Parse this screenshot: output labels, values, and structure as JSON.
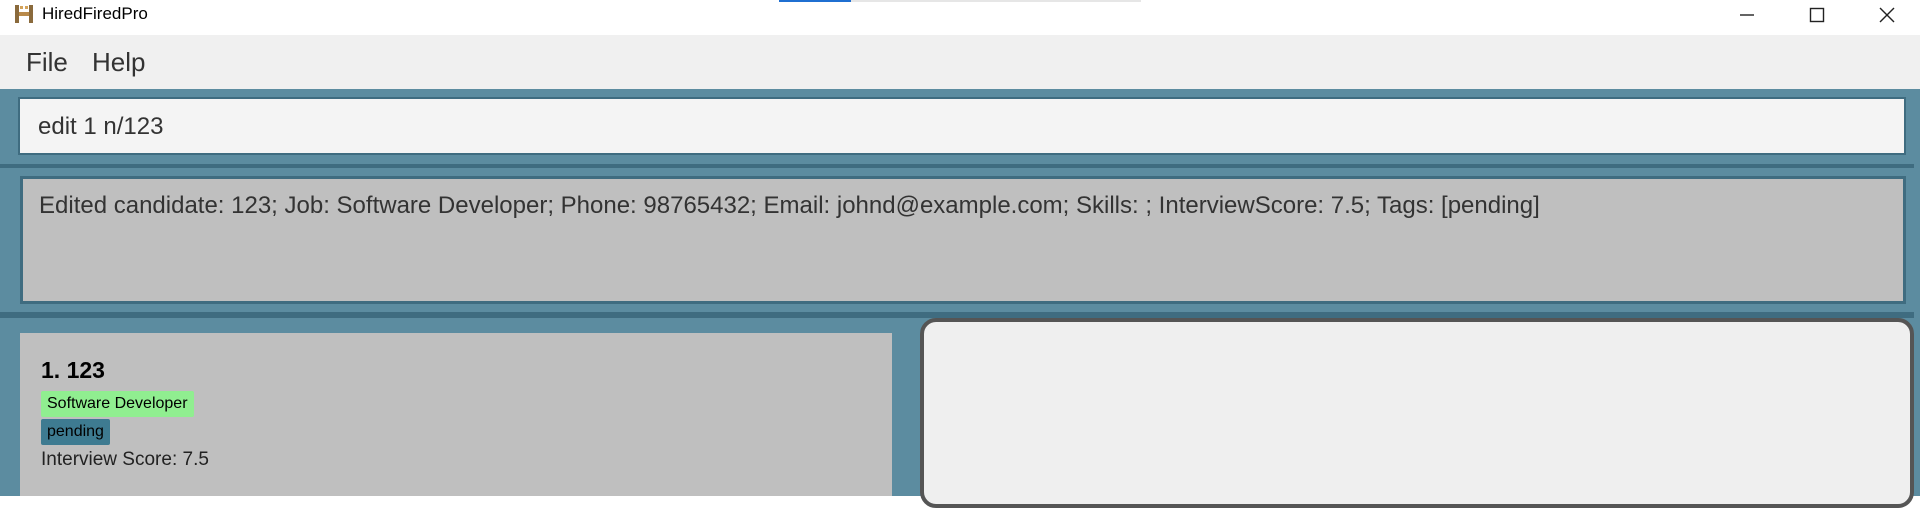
{
  "window": {
    "title": "HiredFiredPro",
    "icon": "app-logo-icon",
    "controls": [
      "minimize-icon",
      "maximize-icon",
      "close-icon"
    ]
  },
  "menu": {
    "file_label": "File",
    "help_label": "Help"
  },
  "command_box": {
    "value": "edit 1 n/123"
  },
  "result_display": {
    "text": "Edited candidate: 123; Job: Software Developer; Phone: 98765432; Email: johnd@example.com; Skills: ; InterviewScore: 7.5; Tags: [pending]"
  },
  "candidates": [
    {
      "index_name": "1. 123",
      "job": "Software Developer",
      "tag": "pending",
      "interview_score": "Interview Score: 7.5"
    }
  ],
  "colors": {
    "panel_bg": "#5c8ca0",
    "border": "#3f6c80",
    "job_badge": "#90ee90",
    "tag_badge": "#3e7b91",
    "card_bg": "#bfbfbf"
  }
}
